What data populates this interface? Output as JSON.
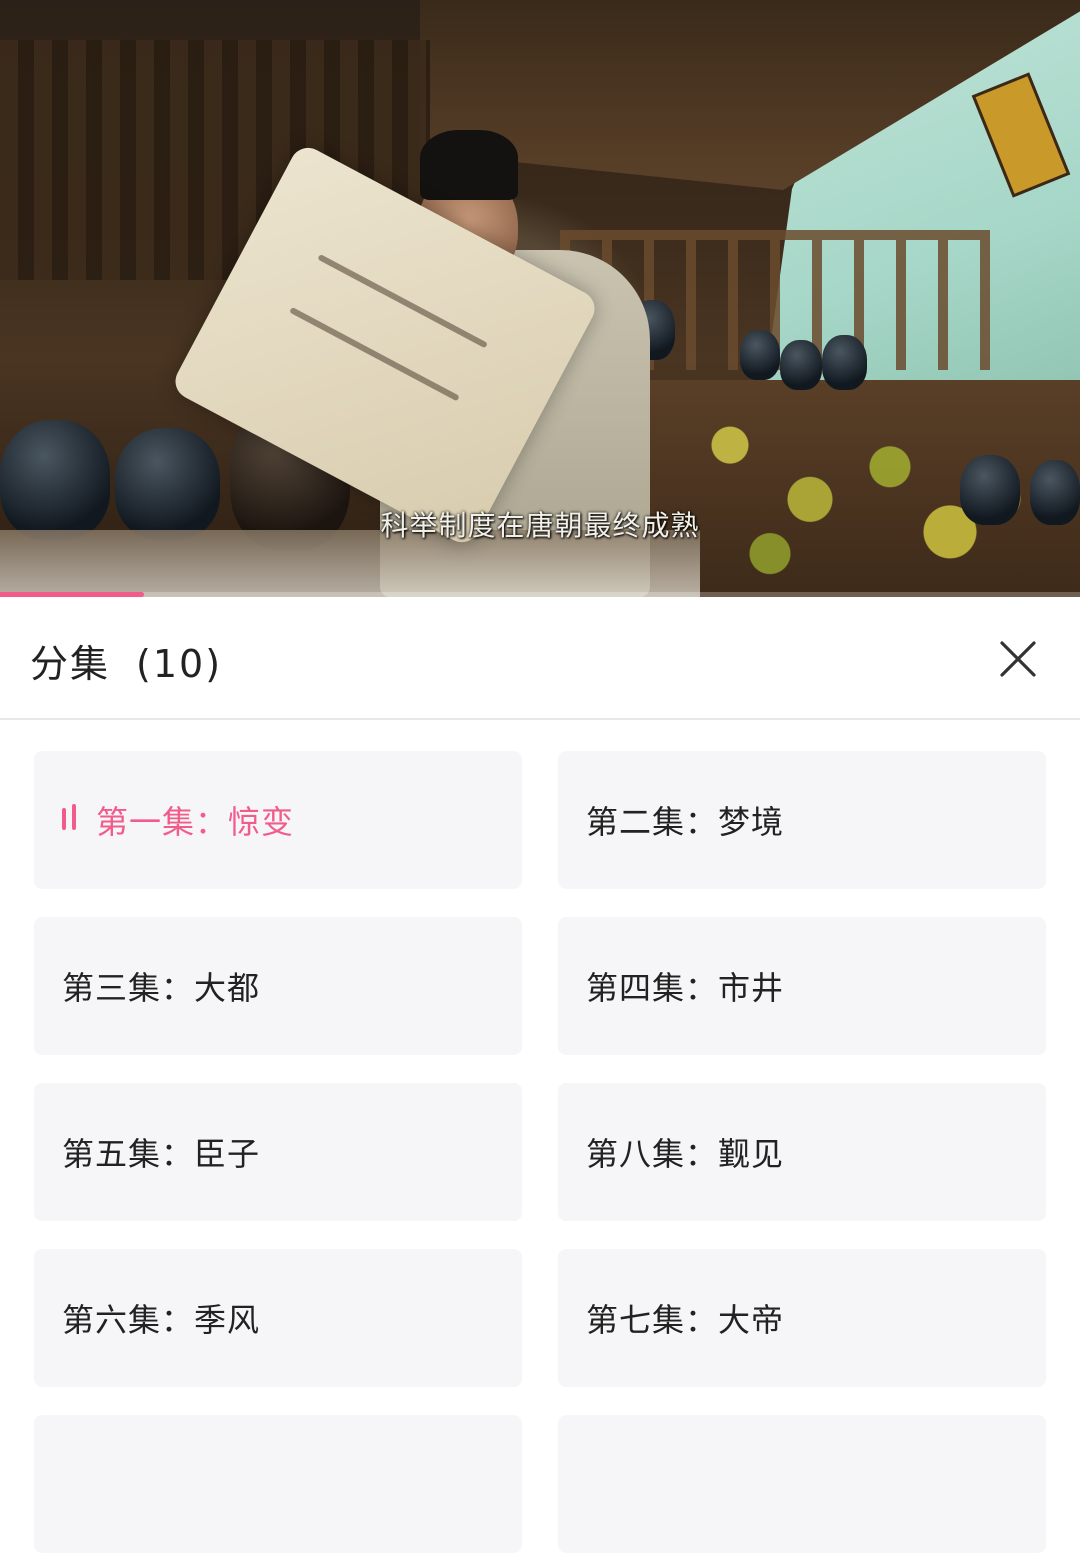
{
  "video": {
    "subtitle": "科举制度在唐朝最终成熟",
    "progress_fraction": 0.133
  },
  "panel": {
    "title": "分集",
    "count": "(10)",
    "close_icon": "close-icon",
    "episodes": [
      {
        "label": "第一集：惊变",
        "active": true
      },
      {
        "label": "第二集：梦境",
        "active": false
      },
      {
        "label": "第三集：大都",
        "active": false
      },
      {
        "label": "第四集：市井",
        "active": false
      },
      {
        "label": "第五集：臣子",
        "active": false
      },
      {
        "label": "第八集：觐见",
        "active": false
      },
      {
        "label": "第六集：季风",
        "active": false
      },
      {
        "label": "第七集：大帝",
        "active": false
      },
      {
        "label": "",
        "active": false
      },
      {
        "label": "",
        "active": false
      }
    ],
    "active_color": "#f25c8b",
    "playing_icon": "playing-bars-icon"
  }
}
